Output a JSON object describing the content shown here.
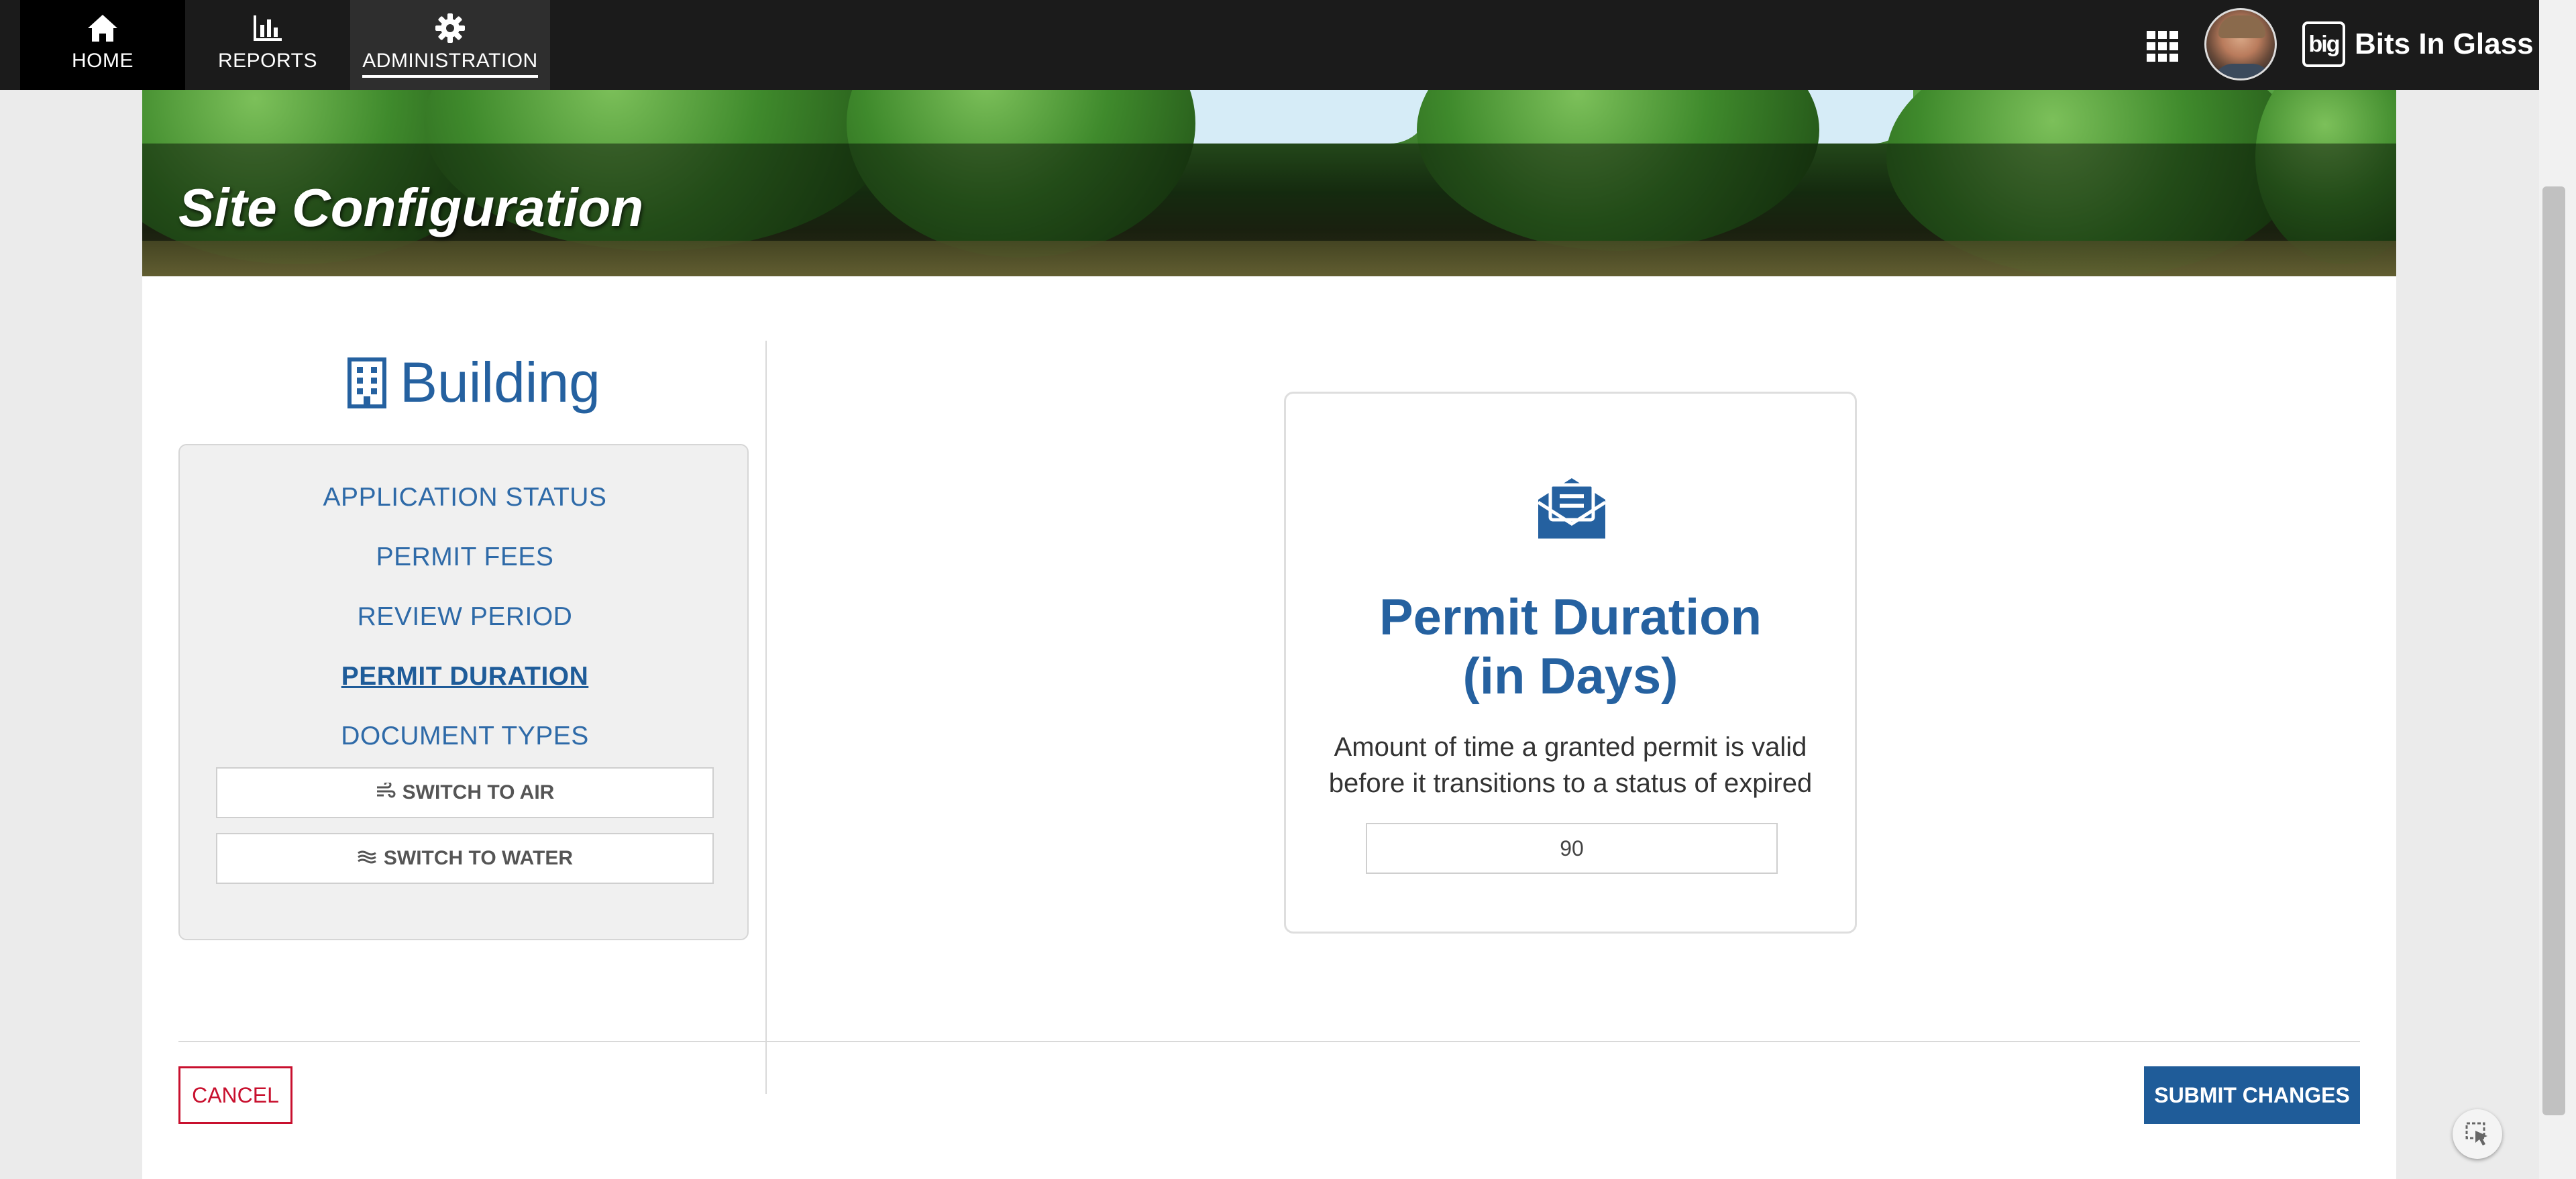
{
  "nav": {
    "items": [
      {
        "label": "HOME",
        "icon": "home-icon"
      },
      {
        "label": "REPORTS",
        "icon": "bar-chart-icon"
      },
      {
        "label": "ADMINISTRATION",
        "icon": "gear-icon",
        "active": true
      }
    ],
    "brand": {
      "logo_text": "big",
      "name": "Bits In Glass"
    }
  },
  "page": {
    "title": "Site Configuration"
  },
  "sidebar": {
    "heading": "Building",
    "heading_icon": "building-icon",
    "menu": [
      {
        "label": "APPLICATION STATUS"
      },
      {
        "label": "PERMIT FEES"
      },
      {
        "label": "REVIEW PERIOD"
      },
      {
        "label": "PERMIT DURATION",
        "active": true
      },
      {
        "label": "DOCUMENT TYPES"
      }
    ],
    "switch_buttons": [
      {
        "label": "SWITCH TO AIR",
        "icon": "wind-icon"
      },
      {
        "label": "SWITCH TO WATER",
        "icon": "water-icon"
      }
    ]
  },
  "card": {
    "icon": "envelope-open-text-icon",
    "title_line1": "Permit Duration",
    "title_line2": "(in Days)",
    "description_line1": "Amount of time a granted permit is valid",
    "description_line2": "before it transitions to a status of expired",
    "value": "90"
  },
  "footer": {
    "cancel_label": "CANCEL",
    "submit_label": "SUBMIT CHANGES"
  },
  "colors": {
    "nav_bg": "#1b1b1b",
    "primary": "#1f5c99",
    "link": "#2e6aa8",
    "cancel": "#c8102e"
  }
}
